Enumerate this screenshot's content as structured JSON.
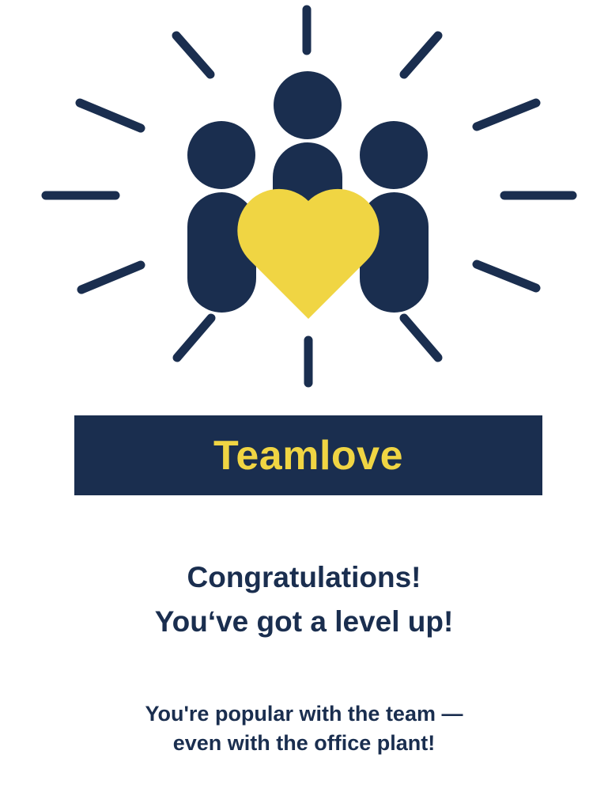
{
  "colors": {
    "navy": "#1a2e4f",
    "yellow": "#f0d543",
    "background": "#ffffff"
  },
  "illustration": {
    "icon": "team-with-heart-icon",
    "rays_icon": "sunburst-rays-icon"
  },
  "banner": {
    "title": "Teamlove"
  },
  "headline": {
    "line1": "Congratulations!",
    "line2": "You‘ve got a level up!"
  },
  "message": {
    "line1": "You're popular with the team —",
    "line2": "even with the office plant!"
  }
}
